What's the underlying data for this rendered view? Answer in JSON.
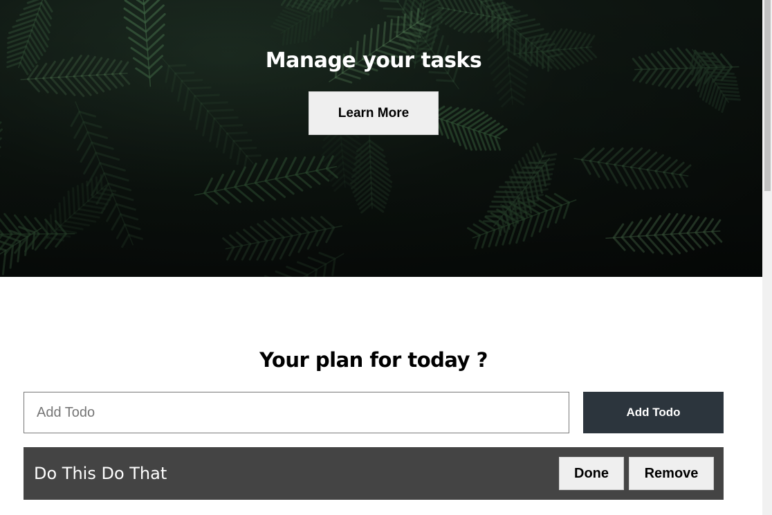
{
  "hero": {
    "title": "Manage your tasks",
    "learn_more_label": "Learn More",
    "background": "dark-palm-leaves"
  },
  "main": {
    "title": "Your plan for today ?",
    "input": {
      "placeholder": "Add Todo",
      "value": ""
    },
    "add_button_label": "Add Todo",
    "todos": [
      {
        "text": "Do This Do That",
        "done_label": "Done",
        "remove_label": "Remove"
      }
    ]
  },
  "colors": {
    "add_button_bg": "#2c353d",
    "todo_item_bg": "#444444",
    "button_bg": "#efefef"
  }
}
